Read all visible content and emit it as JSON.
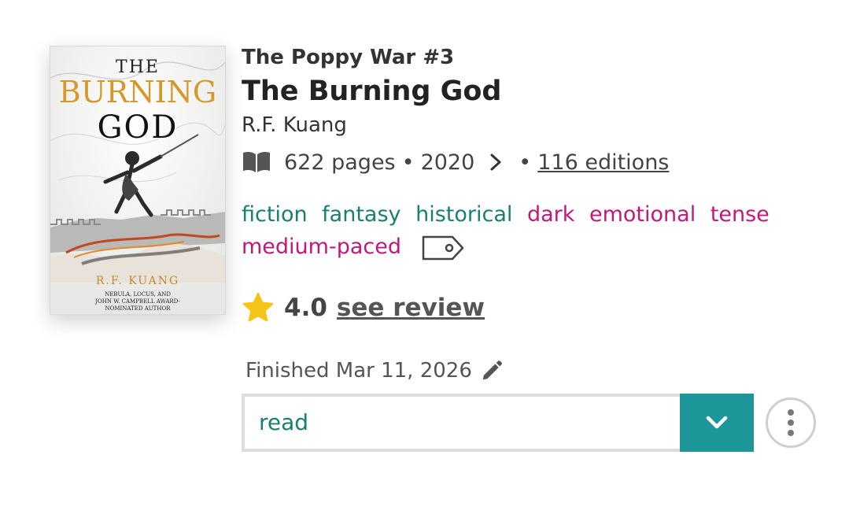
{
  "cover": {
    "title_line1": "THE",
    "title_line2": "BURNING",
    "title_line3": "GOD",
    "author": "R.F. KUANG",
    "blurb": "NEBULA, LOCUS, AND\nJOHN W. CAMPBELL AWARD-\nNOMINATED AUTHOR"
  },
  "book": {
    "series": "The Poppy War #3",
    "title": "The Burning God",
    "author": "R.F. Kuang",
    "pages": "622 pages",
    "separator": "•",
    "year": "2020",
    "editions": "116 editions"
  },
  "tags": [
    {
      "label": "fiction",
      "kind": "genre"
    },
    {
      "label": "fantasy",
      "kind": "genre"
    },
    {
      "label": "historical",
      "kind": "genre"
    },
    {
      "label": "dark",
      "kind": "mood"
    },
    {
      "label": "emotional",
      "kind": "mood"
    },
    {
      "label": "tense",
      "kind": "mood"
    },
    {
      "label": "medium-paced",
      "kind": "pace"
    }
  ],
  "rating": {
    "value": "4.0",
    "review_link": "see review"
  },
  "reading": {
    "finished_label": "Finished Mar 11, 2026",
    "status": "read"
  },
  "icons": {
    "pages": "open-book-icon",
    "expand": "chevron-right-icon",
    "tag": "tag-icon",
    "star": "star-icon",
    "edit": "pencil-icon",
    "dropdown": "chevron-down-icon",
    "more": "more-vertical-icon"
  },
  "colors": {
    "genre_tag": "#17806e",
    "mood_tag": "#c2187a",
    "star": "#f5c518",
    "dropdown_button": "#1d979a",
    "status_text": "#17806e"
  }
}
